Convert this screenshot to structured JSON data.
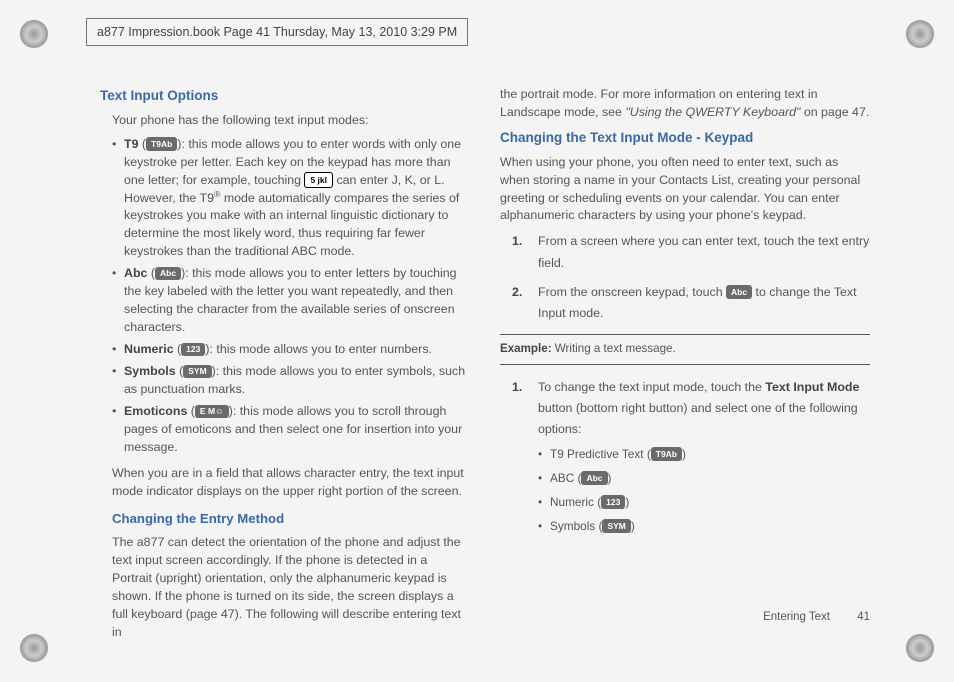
{
  "crop_header": "a877 Impression.book  Page 41  Thursday, May 13, 2010  3:29 PM",
  "col1": {
    "h_text_input_options": "Text Input Options",
    "intro": "Your phone has the following text input modes:",
    "modes": {
      "t9": {
        "label": "T9",
        "icon": "T9Ab",
        "desc_a": ": this mode allows you to enter words with only one keystroke per letter. Each key on the keypad has more than one letter; for example, touching ",
        "jkl_icon": "5 jkl",
        "desc_b": " can enter J, K, or L. However, the T9",
        "reg": "®",
        "desc_c": " mode automatically compares the series of keystrokes you make with an internal linguistic dictionary to determine the most likely word, thus requiring far fewer keystrokes than the traditional ABC mode."
      },
      "abc": {
        "label": "Abc",
        "icon": "Abc",
        "desc": ": this mode allows you to enter letters by touching the key labeled with the letter you want repeatedly, and then selecting the character from the available series of onscreen characters."
      },
      "numeric": {
        "label": "Numeric",
        "icon": "123",
        "desc": ": this mode allows you to enter numbers."
      },
      "symbols": {
        "label": "Symbols",
        "icon": "SYM",
        "desc": ": this mode allows you to enter symbols, such as punctuation marks."
      },
      "emoticons": {
        "label": "Emoticons",
        "icon": "E M☺",
        "desc": ": this mode allows you to scroll through pages of emoticons and then select one for insertion into your message."
      }
    },
    "indicator_note": "When you are in a field that allows character entry, the text input mode indicator displays on the upper right portion of the screen.",
    "h_changing_entry": "Changing the Entry Method",
    "entry_para": "The a877 can detect the orientation of the phone and adjust the text input screen accordingly. If the phone is detected in a Portrait (upright) orientation, only the alphanumeric keypad is shown. If the phone is turned on its side, the screen displays a full keyboard (page 47). The following will describe entering text in"
  },
  "col2": {
    "continue_para_a": "the portrait mode. For more information on entering text in Landscape mode, see ",
    "continue_link": "\"Using the QWERTY Keyboard\"",
    "continue_para_b": " on page 47.",
    "h_changing_keypad": "Changing the Text Input Mode - Keypad",
    "keypad_para": "When using your phone, you often need to enter text, such as when storing a name in your Contacts List, creating your personal greeting or scheduling events on your calendar. You can enter alphanumeric characters by using your phone's keypad.",
    "steps_a": {
      "s1": "From a screen where you can enter text, touch the text entry field.",
      "s2a": "From the onscreen keypad, touch ",
      "s2_icon": "Abc",
      "s2b": " to change the Text Input mode."
    },
    "example_label": "Example:",
    "example_text": " Writing a text message.",
    "steps_b": {
      "s1a": "To change the text input mode, touch the ",
      "s1_bold": "Text Input Mode",
      "s1b": " button (bottom right button) and select one of the following options:"
    },
    "opts": {
      "t9": {
        "label": "T9 Predictive Text (",
        "icon": "T9Ab",
        "close": ")"
      },
      "abc": {
        "label": "ABC (",
        "icon": "Abc",
        "close": ")"
      },
      "numeric": {
        "label": "Numeric (",
        "icon": "123",
        "close": ")"
      },
      "symbols": {
        "label": "Symbols (",
        "icon": "SYM",
        "close": ")"
      }
    }
  },
  "footer": {
    "section": "Entering Text",
    "page": "41"
  }
}
